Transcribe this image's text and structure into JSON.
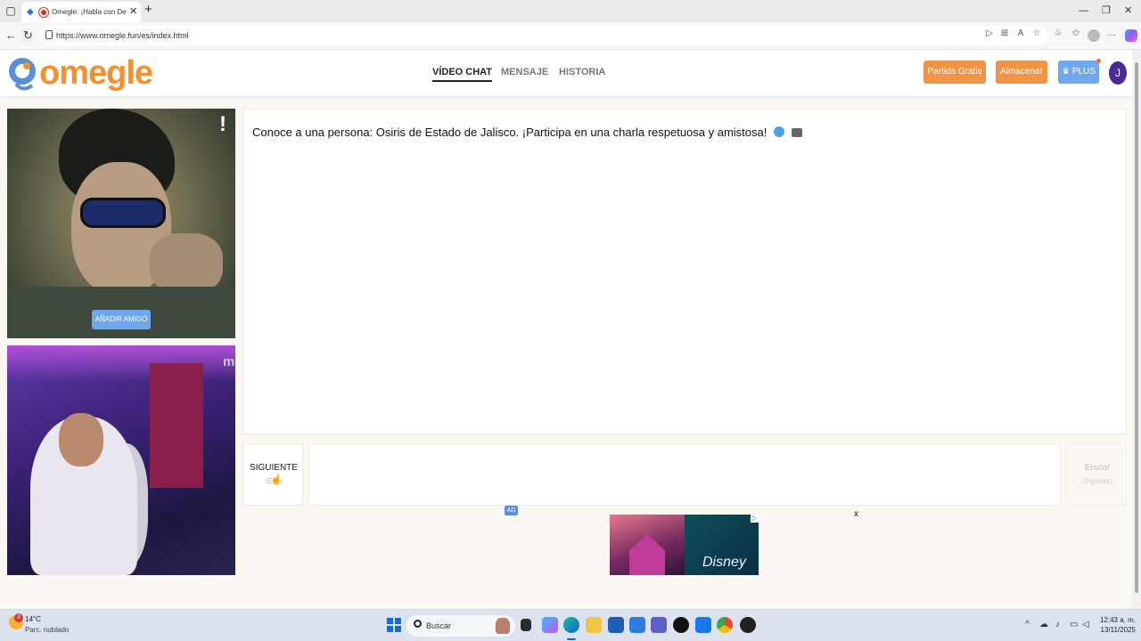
{
  "browser": {
    "tab_title": "Omegle: ¡Habla con Descon",
    "url": "https://www.omegle.fun/es/index.html"
  },
  "site": {
    "logo_text": "omegle",
    "nav": [
      {
        "label": "VÍDEO CHAT",
        "active": true
      },
      {
        "label": "MENSAJE",
        "active": false
      },
      {
        "label": "HISTORIA",
        "active": false
      }
    ],
    "buttons": {
      "partida_gratis": "Partida Gratis",
      "almacenar": "Almacenar",
      "plus": "PLUS"
    },
    "avatar_initial": "J"
  },
  "video": {
    "remote_flag": "!",
    "add_friend_label": "AÑADIR AMIGO",
    "local_watermark": "m"
  },
  "chat": {
    "message": "Conoce a una persona: Osiris de Estado de Jalisco. ¡Participa en una charla respetuosa y amistosa!",
    "next_label": "SIGUIENTE",
    "next_hint": "(Esc)",
    "send_label": "Enviar",
    "send_hint": "(Ingresar)"
  },
  "ad": {
    "tag": "AD",
    "close": "x",
    "brand_text": "Disney"
  },
  "taskbar": {
    "temperature": "14°C",
    "condition": "Parc. nublado",
    "weather_badge": "3",
    "search_placeholder": "Buscar",
    "time": "12:43 a. m.",
    "date": "13/11/2025"
  },
  "colors": {
    "logo_orange": "#f5902f",
    "button_orange": "#f29446",
    "plus_blue": "#6fa7f0",
    "avatar_purple": "#4b2b8f"
  }
}
